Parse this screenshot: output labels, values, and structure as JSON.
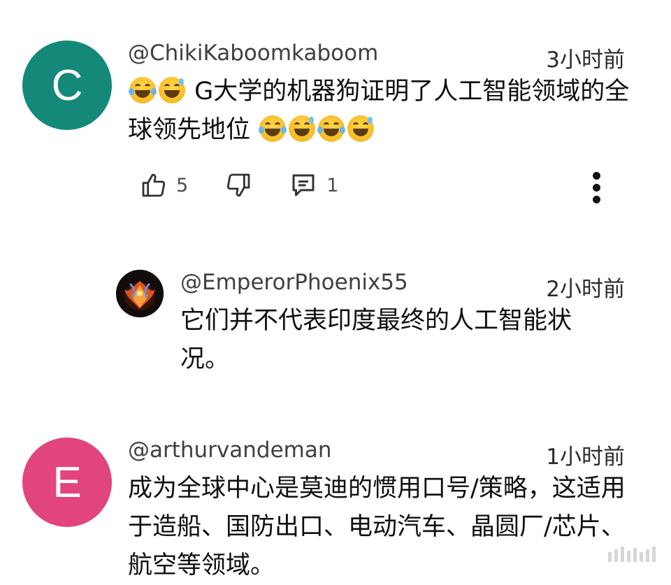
{
  "comments": [
    {
      "avatar_letter": "C",
      "avatar_color": "#14897a",
      "author": "@ChikiKaboomkaboom",
      "time": "3小时前",
      "text_prefix": "G大学的机器狗证明了人工智能领域的全球领先地位",
      "likes": "5",
      "replies": "1"
    },
    {
      "avatar_icon": "phoenix-avatar",
      "author": "@EmperorPhoenix55",
      "time": "2小时前",
      "text": "它们并不代表印度最终的人工智能状况。"
    },
    {
      "avatar_letter": "E",
      "avatar_color": "#e2457e",
      "author": "@arthurvandeman",
      "time": "1小时前",
      "text": "成为全球中心是莫迪的惯用口号/策略，这适用于造船、国防出口、电动汽车、晶圆厂/芯片、航空等领域。"
    }
  ],
  "icons": {
    "like": "thumbs-up-icon",
    "dislike": "thumbs-down-icon",
    "reply": "comment-icon",
    "more": "more-vert-icon",
    "emoji_laugh": "face-with-tears-of-joy",
    "emoji_sweat": "grinning-face-with-sweat"
  }
}
